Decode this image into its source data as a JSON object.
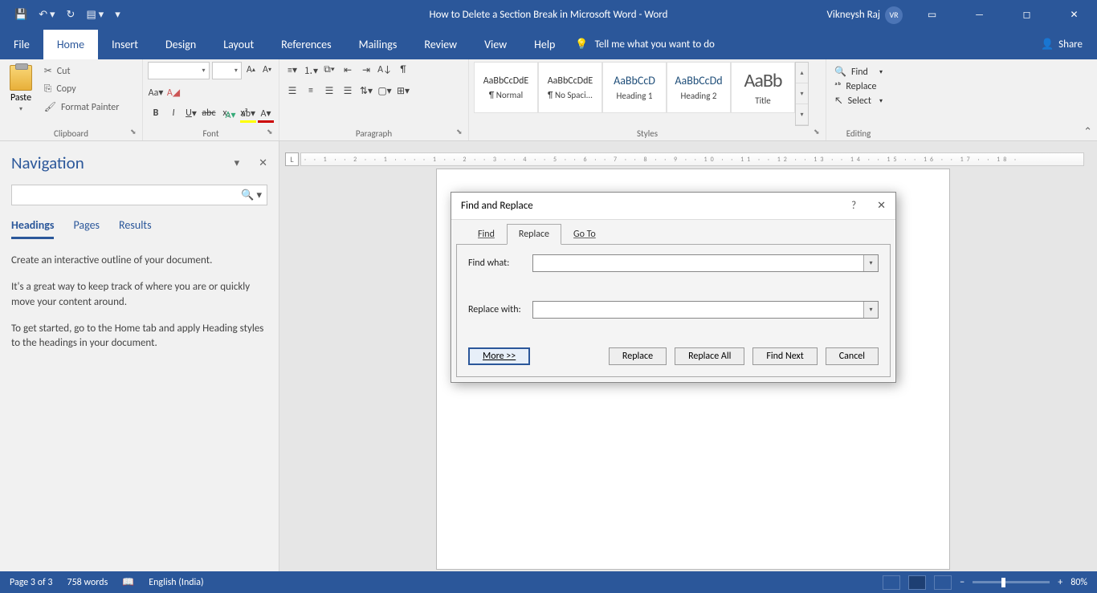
{
  "titlebar": {
    "doc_title": "How to Delete a Section Break in Microsoft Word  -  Word",
    "user_name": "Vikneysh Raj",
    "user_initials": "VR"
  },
  "tabs": {
    "file": "File",
    "home": "Home",
    "insert": "Insert",
    "design": "Design",
    "layout": "Layout",
    "references": "References",
    "mailings": "Mailings",
    "review": "Review",
    "view": "View",
    "help": "Help",
    "tellme": "Tell me what you want to do",
    "share": "Share"
  },
  "ribbon": {
    "clipboard": {
      "label": "Clipboard",
      "paste": "Paste",
      "cut": "Cut",
      "copy": "Copy",
      "format_painter": "Format Painter"
    },
    "font": {
      "label": "Font"
    },
    "paragraph": {
      "label": "Paragraph"
    },
    "styles": {
      "label": "Styles",
      "items": [
        {
          "preview": "AaBbCcDdE",
          "name": "¶ Normal"
        },
        {
          "preview": "AaBbCcDdE",
          "name": "¶ No Spaci..."
        },
        {
          "preview": "AaBbCcD",
          "name": "Heading 1"
        },
        {
          "preview": "AaBbCcDd",
          "name": "Heading 2"
        },
        {
          "preview": "AaBb",
          "name": "Title"
        }
      ]
    },
    "editing": {
      "label": "Editing",
      "find": "Find",
      "replace": "Replace",
      "select": "Select"
    }
  },
  "nav": {
    "title": "Navigation",
    "headings": "Headings",
    "pages": "Pages",
    "results": "Results",
    "p1": "Create an interactive outline of your document.",
    "p2": "It's a great way to keep track of where you are or quickly move your content around.",
    "p3": "To get started, go to the Home tab and apply Heading styles to the headings in your document."
  },
  "dialog": {
    "title": "Find and Replace",
    "tab_find": "Find",
    "tab_replace": "Replace",
    "tab_goto": "Go To",
    "find_what": "Find what:",
    "replace_with": "Replace with:",
    "more": "More >>",
    "replace": "Replace",
    "replace_all": "Replace All",
    "find_next": "Find Next",
    "cancel": "Cancel"
  },
  "status": {
    "page": "Page 3 of 3",
    "words": "758 words",
    "lang": "English (India)",
    "zoom": "80%"
  },
  "ruler": "·  · 1 ·  · 2 ·  · 1 ·  ·  ·  · 1 ·  · 2 ·  · 3 ·  · 4 ·  · 5 ·  · 6 ·  · 7 ·  · 8 ·  · 9 ·  · 10 ·  · 11 ·  · 12 ·  · 13 ·  · 14 ·  · 15 ·  · 16 ·  · 17 ·  · 18 ·"
}
